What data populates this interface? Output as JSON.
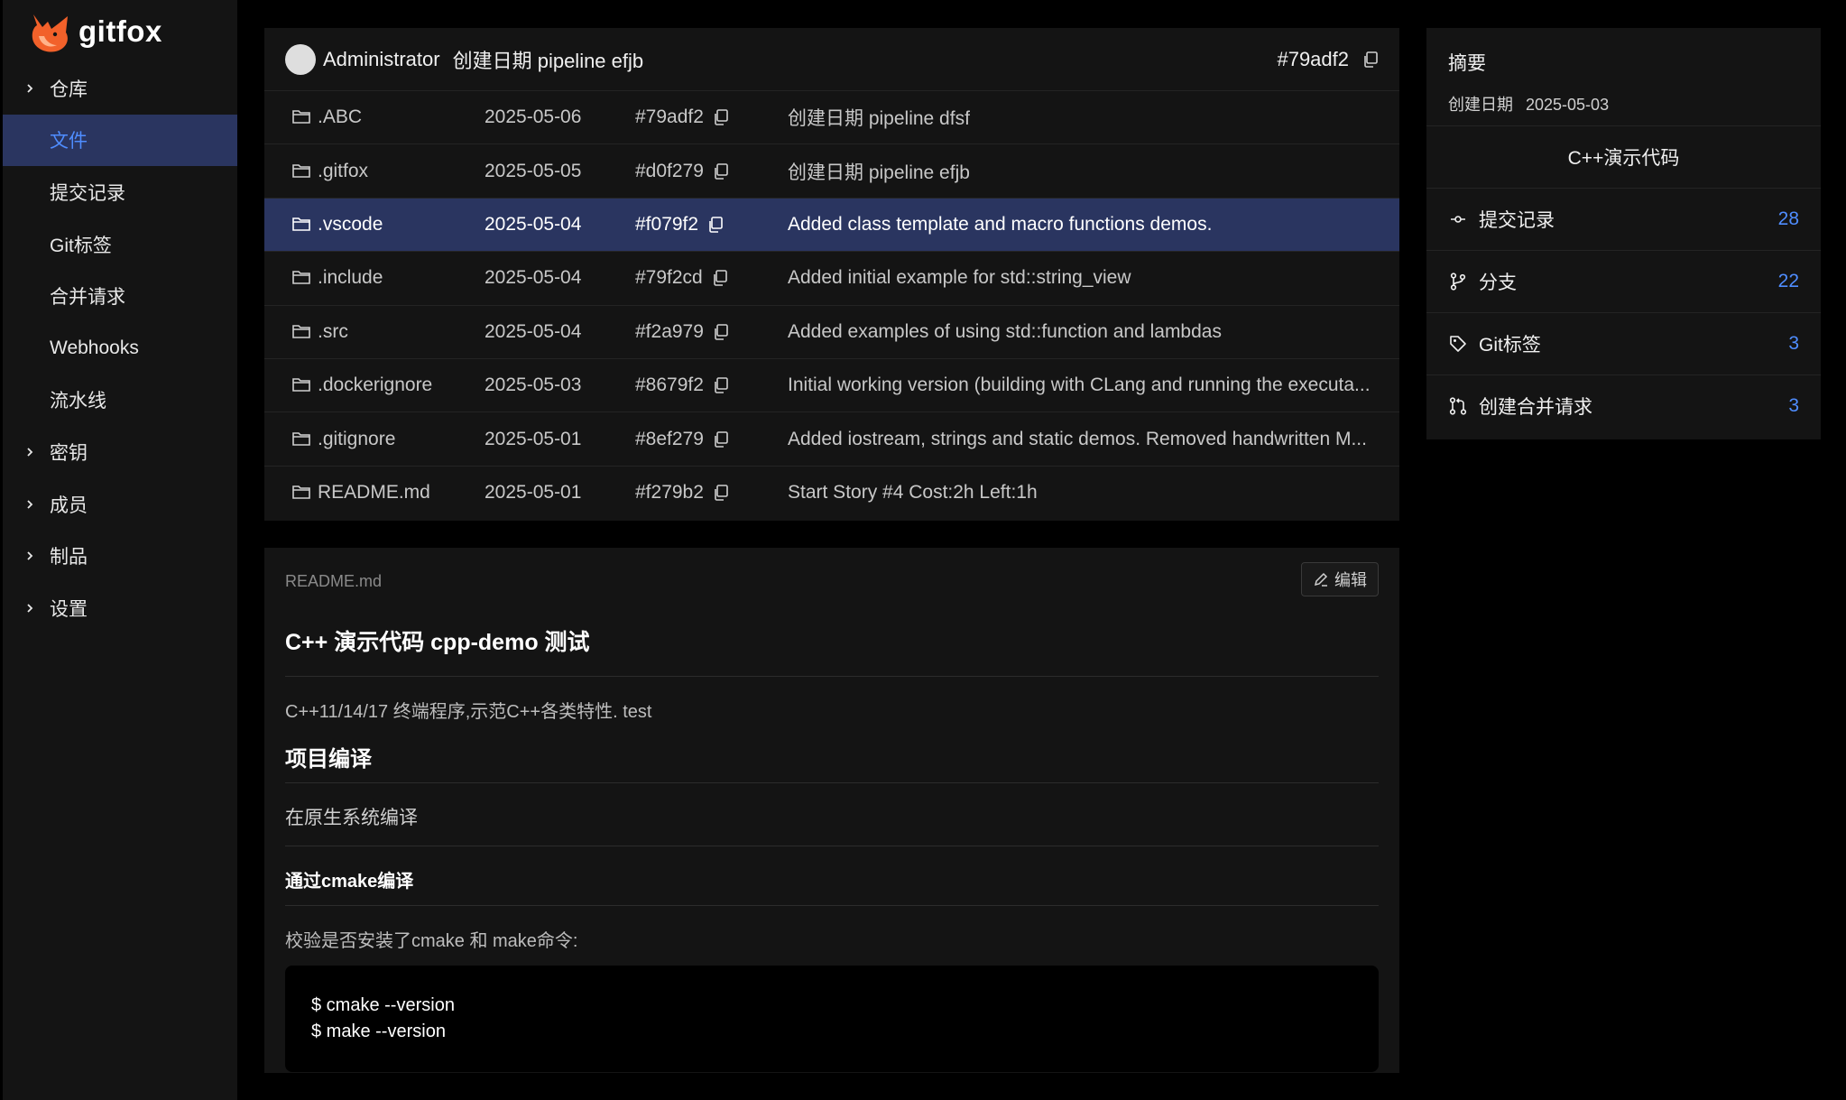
{
  "brand": {
    "name": "gitfox"
  },
  "sidebar": {
    "items": [
      {
        "label": "仓库",
        "expandable": true,
        "active": false
      },
      {
        "label": "文件",
        "expandable": false,
        "active": true
      },
      {
        "label": "提交记录",
        "expandable": false,
        "active": false
      },
      {
        "label": "Git标签",
        "expandable": false,
        "active": false
      },
      {
        "label": "合并请求",
        "expandable": false,
        "active": false
      },
      {
        "label": "Webhooks",
        "expandable": false,
        "active": false
      },
      {
        "label": "流水线",
        "expandable": false,
        "active": false
      },
      {
        "label": "密钥",
        "expandable": true,
        "active": false
      },
      {
        "label": "成员",
        "expandable": true,
        "active": false
      },
      {
        "label": "制品",
        "expandable": true,
        "active": false
      },
      {
        "label": "设置",
        "expandable": true,
        "active": false
      }
    ]
  },
  "latest_commit": {
    "author": "Administrator",
    "message": "创建日期 pipeline efjb",
    "hash": "#79adf2"
  },
  "files": [
    {
      "name": ".ABC",
      "date": "2025-05-06",
      "hash": "#79adf2",
      "message": "创建日期 pipeline dfsf"
    },
    {
      "name": ".gitfox",
      "date": "2025-05-05",
      "hash": "#d0f279",
      "message": "创建日期 pipeline efjb"
    },
    {
      "name": ".vscode",
      "date": "2025-05-04",
      "hash": "#f079f2",
      "message": "Added class template and macro functions demos."
    },
    {
      "name": ".include",
      "date": "2025-05-04",
      "hash": "#79f2cd",
      "message": "Added initial example for std::string_view"
    },
    {
      "name": ".src",
      "date": "2025-05-04",
      "hash": "#f2a979",
      "message": "Added examples of using std::function and lambdas"
    },
    {
      "name": ".dockerignore",
      "date": "2025-05-03",
      "hash": "#8679f2",
      "message": "Initial working version (building with CLang and running the executa..."
    },
    {
      "name": ".gitignore",
      "date": "2025-05-01",
      "hash": "#8ef279",
      "message": "Added iostream, strings and static demos. Removed handwritten M..."
    },
    {
      "name": "README.md",
      "date": "2025-05-01",
      "hash": "#f279b2",
      "message": "Start Story #4 Cost:2h Left:1h"
    }
  ],
  "selected_file_index": 2,
  "readme": {
    "filename": "README.md",
    "edit_label": "编辑",
    "h1": "C++ 演示代码 cpp-demo 测试",
    "description": "C++11/14/17 终端程序,示范C++各类特性. test",
    "h2": "项目编译",
    "p1": "在原生系统编译",
    "h3": "通过cmake编译",
    "p2": "校验是否安装了cmake 和 make命令:",
    "code": [
      "$ cmake --version",
      "$ make --version"
    ]
  },
  "summary": {
    "title": "摘要",
    "created_label": "创建日期",
    "created_date": "2025-05-03",
    "repo_name": "C++演示代码",
    "stats": [
      {
        "icon": "commit-icon",
        "label": "提交记录",
        "count": "28"
      },
      {
        "icon": "branch-icon",
        "label": "分支",
        "count": "22"
      },
      {
        "icon": "tag-icon",
        "label": "Git标签",
        "count": "3"
      },
      {
        "icon": "merge-request-icon",
        "label": "创建合并请求",
        "count": "3"
      }
    ]
  },
  "colors": {
    "accent": "#4f8dff",
    "selected_bg": "#2a3560",
    "panel_bg": "#141414",
    "page_bg": "#000000",
    "logo_orange": "#f2612a"
  }
}
